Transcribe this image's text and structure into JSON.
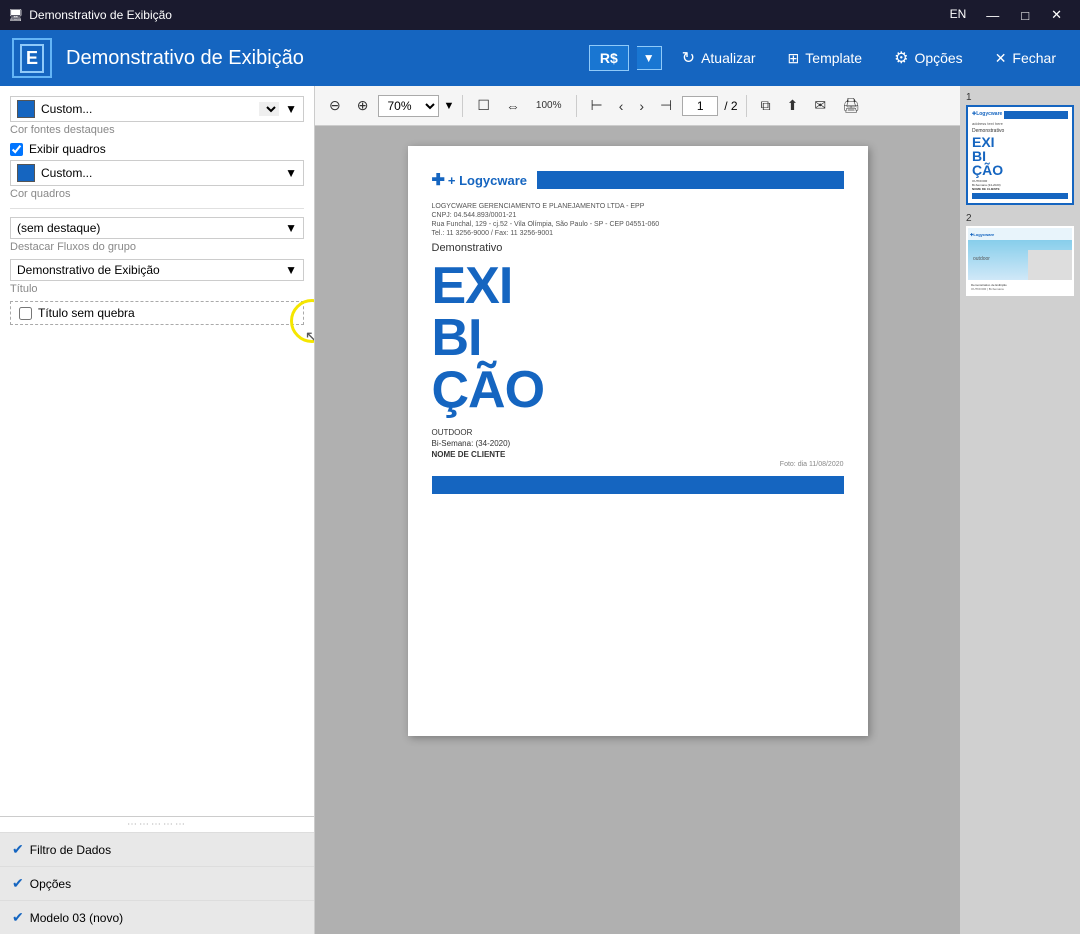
{
  "titlebar": {
    "icon": "🖥",
    "title": "Demonstrativo de Exibição",
    "lang": "EN",
    "minimize": "—",
    "maximize": "□",
    "close": "✕"
  },
  "toolbar": {
    "app_icon": "E",
    "app_title": "Demonstrativo de Exibição",
    "currency": "R$",
    "currency_dropdown": "▼",
    "atualizar": "Atualizar",
    "template": "Template",
    "opcoes": "Opções",
    "fechar": "Fechar"
  },
  "left_panel": {
    "custom_label1": "Custom...",
    "cor_fontes": "Cor fontes destaques",
    "exibir_quadros": "Exibir quadros",
    "custom_label2": "Custom...",
    "cor_quadros": "Cor quadros",
    "sem_destaque": "(sem destaque)",
    "destacar_fluxos": "Destacar Fluxos do grupo",
    "demo_exibicao": "Demonstrativo de Exibição",
    "titulo_label": "Título",
    "titulo_sem_quebra": "Título sem quebra"
  },
  "bottom_accordion": {
    "filtro": "Filtro de Dados",
    "opcoes": "Opções",
    "modelo": "Modelo 03 (novo)"
  },
  "view_toolbar": {
    "zoom_out": "⊖",
    "zoom_in": "⊕",
    "zoom_level": "70%",
    "zoom_dropdown": "▼",
    "page_icon": "☐",
    "fit_icon": "⇔",
    "percent_icon": "100%",
    "first": "⊢",
    "prev": "‹",
    "next": "›",
    "last": "⊣",
    "current_page": "1",
    "total_pages": "/ 2",
    "copy_icon": "⧉",
    "share_icon": "⬆",
    "mail_icon": "✉",
    "print_icon": "🖨"
  },
  "document": {
    "logo": "+ Logycware",
    "address_line1": "LOGYCWARE GERENCIAMENTO E PLANEJAMENTO LTDA - EPP",
    "address_line2": "CNPJ: 04.544.893/0001-21",
    "address_line3": "Rua Funchal, 129 - cj.52 - Vila Olímpia, São Paulo - SP - CEP 04551-060",
    "address_line4": "Tel.: 11 3256-9000 / Fax: 11 3256-9001",
    "subtitle": "Demonstrativo",
    "big_title_line1": "EXI",
    "big_title_line2": "BI",
    "big_title_line3": "ÇÃO",
    "info_type": "OUTDOOR",
    "info_semana": "Bi-Semana: (34-2020)",
    "info_cliente": "NOME DE CLIENTE",
    "date_label": "Foto: dia 11/08/2020"
  },
  "thumbnails": [
    {
      "num": "1",
      "active": true,
      "type": "cover"
    },
    {
      "num": "2",
      "active": false,
      "type": "photo"
    }
  ]
}
